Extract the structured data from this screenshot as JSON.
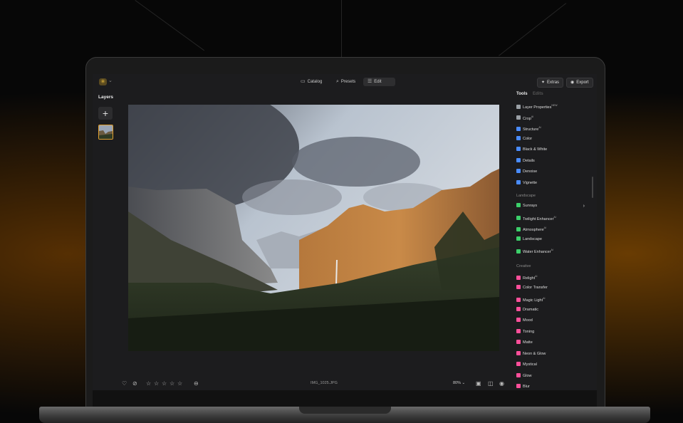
{
  "topbar": {
    "tabs": [
      {
        "label": "Catalog",
        "icon": "folder-icon"
      },
      {
        "label": "Presets",
        "icon": "search-icon"
      },
      {
        "label": "Edit",
        "icon": "sliders-icon"
      }
    ],
    "extras_label": "Extras",
    "export_label": "Export"
  },
  "layers": {
    "title": "Layers"
  },
  "panel": {
    "tools_tab": "Tools",
    "edits_tab": "Edits",
    "essentials": [
      {
        "label": "Layer Properties",
        "badge": "NEW",
        "color": "#9aa0a6"
      },
      {
        "label": "Crop",
        "badge": "AI",
        "color": "#9aa0a6"
      },
      {
        "label": "Structure",
        "badge": "AI",
        "color": "#4a8cff"
      },
      {
        "label": "Color",
        "badge": "",
        "color": "#4a8cff"
      },
      {
        "label": "Black & White",
        "badge": "",
        "color": "#4a8cff"
      },
      {
        "label": "Details",
        "badge": "",
        "color": "#4a8cff"
      },
      {
        "label": "Denoise",
        "badge": "",
        "color": "#4a8cff"
      },
      {
        "label": "Vignette",
        "badge": "",
        "color": "#4a8cff"
      }
    ],
    "landscape_title": "Landscape",
    "landscape": [
      {
        "label": "Sunrays",
        "badge": "",
        "color": "#3ccf6a"
      },
      {
        "label": "Twilight Enhancer",
        "badge": "AI",
        "color": "#3ccf6a"
      },
      {
        "label": "Atmosphere",
        "badge": "AI",
        "color": "#3ccf6a"
      },
      {
        "label": "Landscape",
        "badge": "",
        "color": "#3ccf6a"
      },
      {
        "label": "Water Enhancer",
        "badge": "AI",
        "color": "#3ccf6a"
      }
    ],
    "creative_title": "Creative",
    "creative": [
      {
        "label": "Relight",
        "badge": "AI",
        "color": "#ff4f9a"
      },
      {
        "label": "Color Transfer",
        "badge": "",
        "color": "#ff4f9a"
      },
      {
        "label": "Magic Light",
        "badge": "AI",
        "color": "#ff4f9a"
      },
      {
        "label": "Dramatic",
        "badge": "",
        "color": "#ff4f9a"
      },
      {
        "label": "Mood",
        "badge": "",
        "color": "#ff4f9a"
      },
      {
        "label": "Toning",
        "badge": "",
        "color": "#ff4f9a"
      },
      {
        "label": "Matte",
        "badge": "",
        "color": "#ff4f9a"
      },
      {
        "label": "Neon & Glow",
        "badge": "",
        "color": "#ff4f9a"
      },
      {
        "label": "Mystical",
        "badge": "",
        "color": "#ff4f9a"
      },
      {
        "label": "Glow",
        "badge": "",
        "color": "#ff4f9a"
      },
      {
        "label": "Blur",
        "badge": "",
        "color": "#ff4f9a"
      }
    ]
  },
  "bottombar": {
    "filename": "IMG_1025.JPG",
    "zoom": "80%"
  }
}
